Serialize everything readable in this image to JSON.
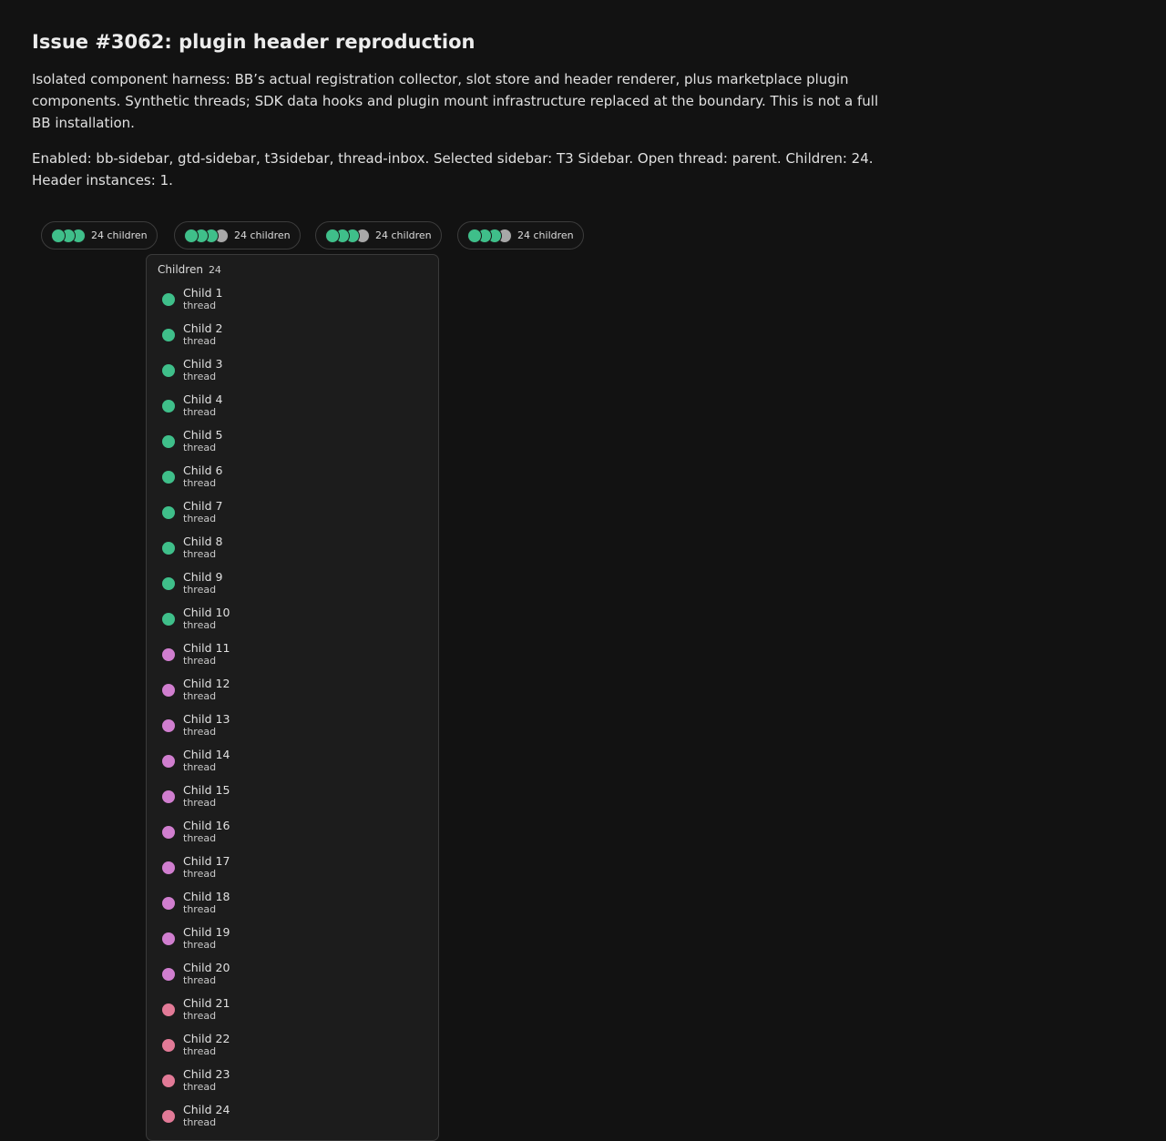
{
  "title": "Issue #3062: plugin header reproduction",
  "description": "Isolated component harness: BB’s actual registration collector, slot store and header renderer, plus marketplace plugin components. Synthetic threads; SDK data hooks and plugin mount infrastructure replaced at the boundary. This is not a full BB installation.",
  "status": "Enabled: bb-sidebar, gtd-sidebar, t3sidebar, thread-inbox. Selected sidebar: T3 Sidebar. Open thread: parent. Children: 24. Header instances: 1.",
  "colors": {
    "green": "#3fbf8a",
    "purple": "#d07ecf",
    "pink": "#e27a97",
    "gray": "#a8a8a8"
  },
  "pills": [
    {
      "label": "24 children",
      "avatars": [
        "green",
        "green",
        "green"
      ]
    },
    {
      "label": "24 children",
      "avatars": [
        "green",
        "green",
        "green",
        "gray"
      ]
    },
    {
      "label": "24 children",
      "avatars": [
        "green",
        "green",
        "green",
        "gray"
      ]
    },
    {
      "label": "24 children",
      "avatars": [
        "green",
        "green",
        "green",
        "gray"
      ]
    }
  ],
  "dropdown": {
    "heading": "Children",
    "count": "24",
    "items": [
      {
        "name": "Child 1",
        "sub": "thread",
        "color": "green"
      },
      {
        "name": "Child 2",
        "sub": "thread",
        "color": "green"
      },
      {
        "name": "Child 3",
        "sub": "thread",
        "color": "green"
      },
      {
        "name": "Child 4",
        "sub": "thread",
        "color": "green"
      },
      {
        "name": "Child 5",
        "sub": "thread",
        "color": "green"
      },
      {
        "name": "Child 6",
        "sub": "thread",
        "color": "green"
      },
      {
        "name": "Child 7",
        "sub": "thread",
        "color": "green"
      },
      {
        "name": "Child 8",
        "sub": "thread",
        "color": "green"
      },
      {
        "name": "Child 9",
        "sub": "thread",
        "color": "green"
      },
      {
        "name": "Child 10",
        "sub": "thread",
        "color": "green"
      },
      {
        "name": "Child 11",
        "sub": "thread",
        "color": "purple"
      },
      {
        "name": "Child 12",
        "sub": "thread",
        "color": "purple"
      },
      {
        "name": "Child 13",
        "sub": "thread",
        "color": "purple"
      },
      {
        "name": "Child 14",
        "sub": "thread",
        "color": "purple"
      },
      {
        "name": "Child 15",
        "sub": "thread",
        "color": "purple"
      },
      {
        "name": "Child 16",
        "sub": "thread",
        "color": "purple"
      },
      {
        "name": "Child 17",
        "sub": "thread",
        "color": "purple"
      },
      {
        "name": "Child 18",
        "sub": "thread",
        "color": "purple"
      },
      {
        "name": "Child 19",
        "sub": "thread",
        "color": "purple"
      },
      {
        "name": "Child 20",
        "sub": "thread",
        "color": "purple"
      },
      {
        "name": "Child 21",
        "sub": "thread",
        "color": "pink"
      },
      {
        "name": "Child 22",
        "sub": "thread",
        "color": "pink"
      },
      {
        "name": "Child 23",
        "sub": "thread",
        "color": "pink"
      },
      {
        "name": "Child 24",
        "sub": "thread",
        "color": "pink"
      }
    ]
  }
}
